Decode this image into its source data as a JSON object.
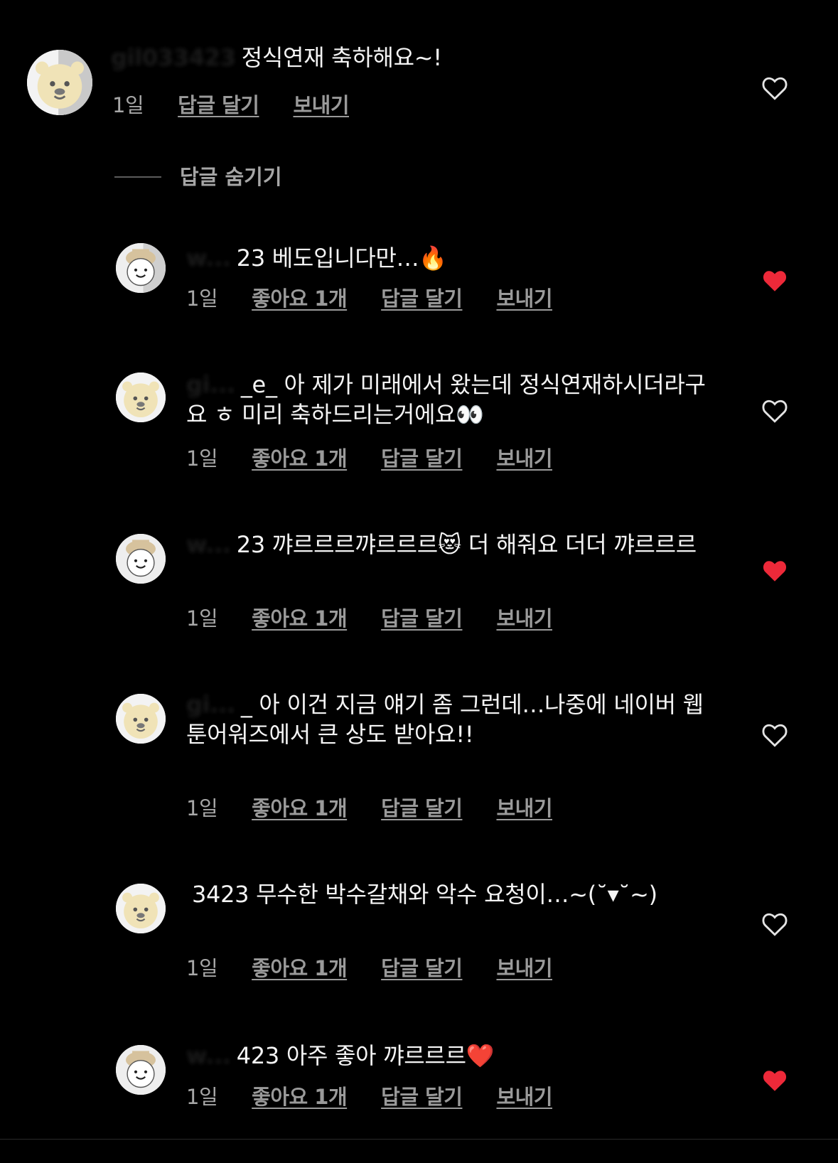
{
  "colors": {
    "background": "#000000",
    "text": "#f4f4f4",
    "meta": "#9a9a9a",
    "liked_heart": "#ed2939",
    "outline_heart": "#e4e4e4"
  },
  "main_comment": {
    "username": "gil033423",
    "text": "정식연재 축하해요~!",
    "time": "1일",
    "reply_label": "답글 달기",
    "send_label": "보내기",
    "avatar": "bear-avatar-icon",
    "liked": false
  },
  "hide_replies_label": "답글 숨기기",
  "replies": [
    {
      "username": "w...",
      "text": "23 베도입니다만…🔥",
      "time": "1일",
      "likes_label": "좋아요 1개",
      "reply_label": "답글 달기",
      "send_label": "보내기",
      "avatar": "hat-character-avatar-icon",
      "liked": true
    },
    {
      "username": "gi...",
      "text": "_e_ 아 제가 미래에서 왔는데 정식연재하시더라구요 ㅎ 미리 축하드리는거에요👀",
      "time": "1일",
      "likes_label": "좋아요 1개",
      "reply_label": "답글 달기",
      "send_label": "보내기",
      "avatar": "bear-avatar-icon",
      "liked": false
    },
    {
      "username": "w...",
      "text": "23 꺄르르르꺄르르르😻 더 해줘요 더더 꺄르르르",
      "time": "1일",
      "likes_label": "좋아요 1개",
      "reply_label": "답글 달기",
      "send_label": "보내기",
      "avatar": "hat-character-avatar-icon",
      "liked": true
    },
    {
      "username": "gi...",
      "text": "_ 아 이건 지금 얘기 좀 그런데…나중에 네이버 웹툰어워즈에서 큰 상도 받아요!!",
      "time": "1일",
      "likes_label": "좋아요 1개",
      "reply_label": "답글 달기",
      "send_label": "보내기",
      "avatar": "bear-avatar-icon",
      "liked": false
    },
    {
      "username": "",
      "text": "3423 무수한 박수갈채와 악수 요청이…~(˘▾˘~)",
      "time": "1일",
      "likes_label": "좋아요 1개",
      "reply_label": "답글 달기",
      "send_label": "보내기",
      "avatar": "bear-avatar-icon",
      "liked": false
    },
    {
      "username": "w...",
      "text": "423 아주 좋아 꺄르르르❤️",
      "time": "1일",
      "likes_label": "좋아요 1개",
      "reply_label": "답글 달기",
      "send_label": "보내기",
      "avatar": "hat-character-avatar-icon",
      "liked": true
    }
  ]
}
